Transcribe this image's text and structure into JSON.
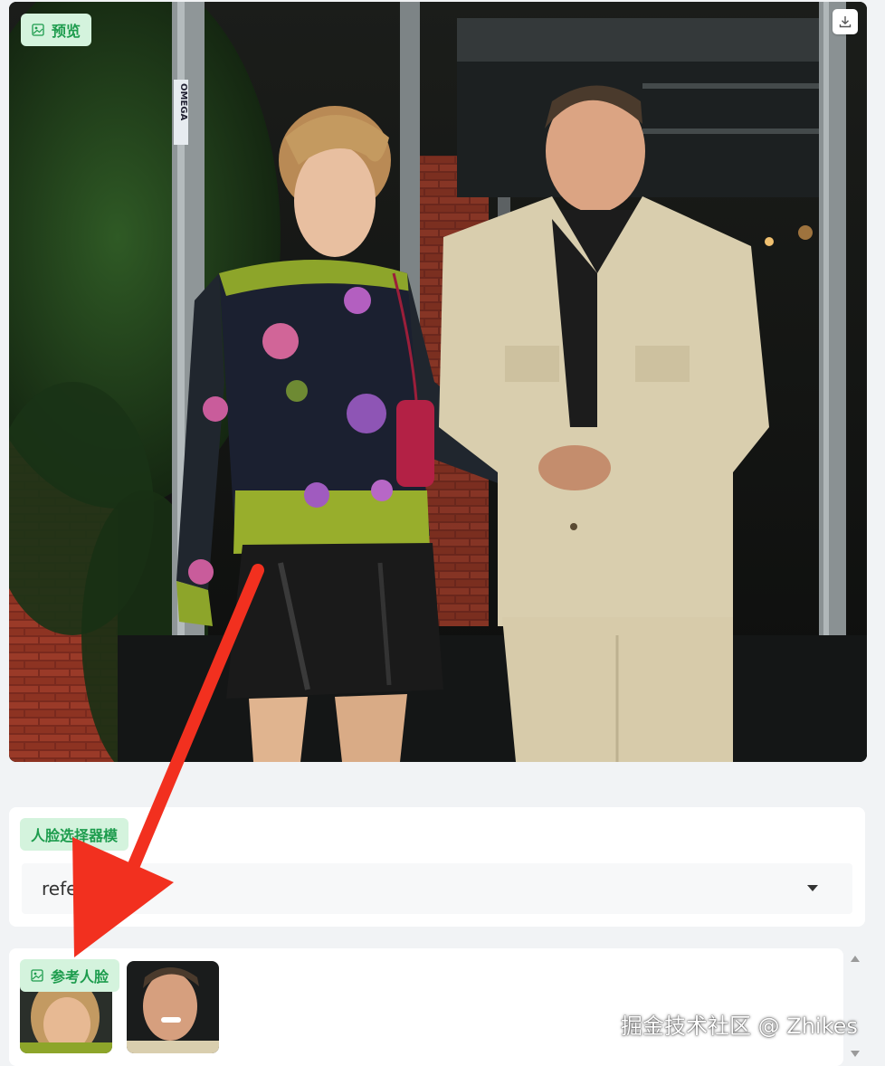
{
  "preview": {
    "label": "预览",
    "label_icon": "image-icon",
    "download_icon": "download-icon",
    "pole_sign": "OMEGA"
  },
  "face_selector": {
    "label": "人脸选择器模",
    "label_icon": "",
    "value": "refe",
    "caret_icon": "caret-down-icon"
  },
  "reference_face": {
    "label": "参考人脸",
    "label_icon": "image-icon"
  },
  "watermark": "掘金技术社区 @ Zhikes",
  "colors": {
    "tag_bg": "#d4f3dd",
    "tag_text": "#1d9c4d",
    "annotation_arrow": "#f2301f",
    "page_bg": "#f1f3f5"
  }
}
